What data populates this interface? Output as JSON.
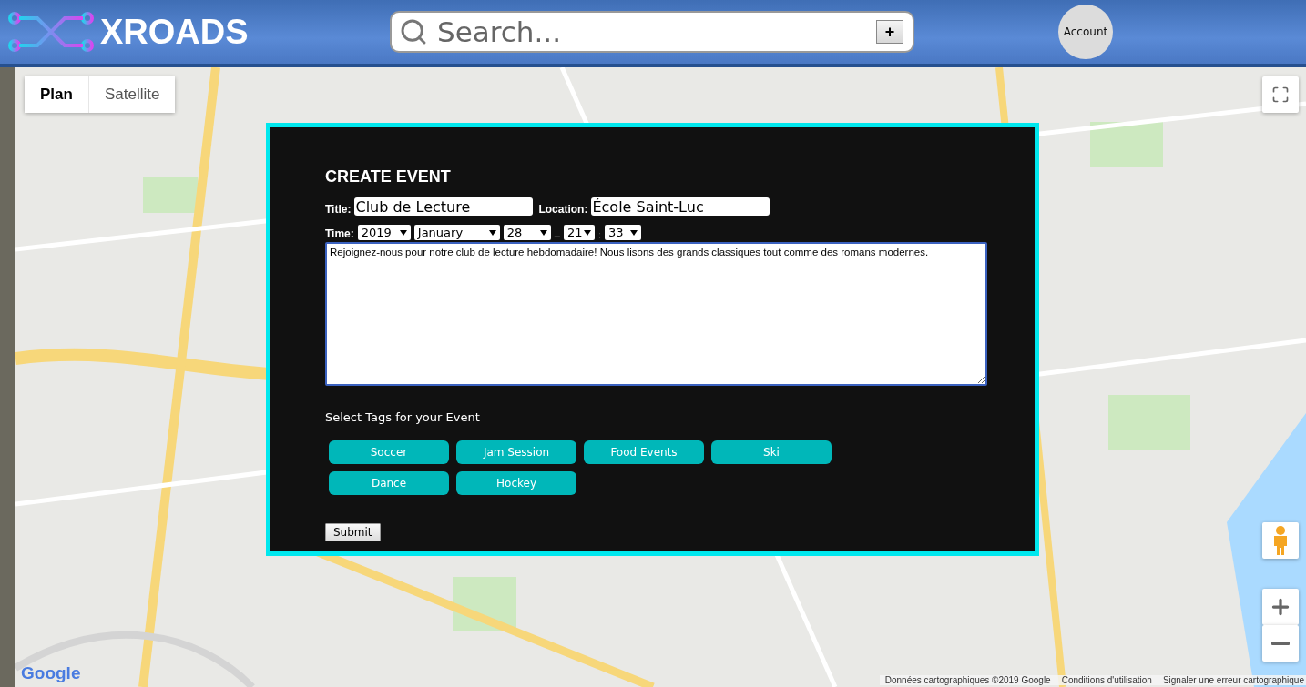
{
  "header": {
    "brand": "XROADS",
    "search": {
      "placeholder": "Search...",
      "add_button": "+"
    },
    "account": "Account"
  },
  "map": {
    "kind": "picture",
    "map_types": [
      {
        "label": "Plan",
        "selected": true
      },
      {
        "label": "Satellite",
        "selected": false
      }
    ],
    "logo": "Google",
    "attribution": [
      "Données cartographiques ©2019 Google",
      "Conditions d'utilisation",
      "Signaler une erreur cartographique"
    ]
  },
  "dialog": {
    "title": "CREATE EVENT",
    "title_label": "Title:",
    "title_value": "Club de Lecture",
    "location_label": "Location:",
    "location_value": "École Saint-Luc",
    "time_label": "Time:",
    "time": [
      {
        "kind": "select",
        "value": "2019"
      },
      {
        "kind": "select",
        "value": "January"
      },
      {
        "kind": "select",
        "value": "28"
      },
      {
        "kind": "separator",
        "value": "–"
      },
      {
        "kind": "select",
        "value": "21"
      },
      {
        "kind": "separator",
        "value": ":"
      },
      {
        "kind": "select",
        "value": "33"
      }
    ],
    "description": "Rejoignez-nous pour notre club de lecture hebdomadaire! Nous lisons des grands classiques tout comme des romans modernes.",
    "tags_label": "Select Tags for your Event",
    "tags": [
      "Soccer",
      "Jam Session",
      "Food Events",
      "Ski",
      "Dance",
      "Hockey"
    ],
    "submit": "Submit"
  }
}
